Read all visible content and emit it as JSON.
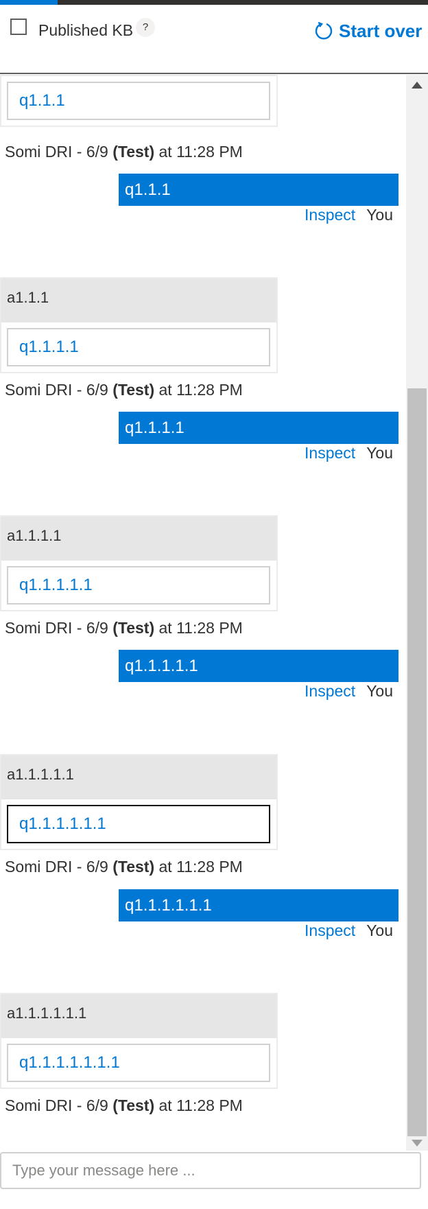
{
  "header": {
    "published_kb_label": "Published KB",
    "published_kb_checked": false,
    "help_glyph": "?",
    "start_over_label": "Start over"
  },
  "conversation": {
    "bot_messages": [
      {
        "text": "",
        "button": "q1.1.1"
      },
      {
        "text": "a1.1.1",
        "button": "q1.1.1.1"
      },
      {
        "text": "a1.1.1.1",
        "button": "q1.1.1.1.1"
      },
      {
        "text": "a1.1.1.1.1",
        "button": "q1.1.1.1.1.1"
      },
      {
        "text": "a1.1.1.1.1.1",
        "button": "q1.1.1.1.1.1.1"
      }
    ],
    "bot_meta": {
      "name": "Somi DRI - 6/9",
      "env": "(Test)",
      "time": "at 11:28 PM"
    },
    "user_messages": [
      {
        "text": "q1.1.1"
      },
      {
        "text": "q1.1.1.1"
      },
      {
        "text": "q1.1.1.1.1"
      },
      {
        "text": "q1.1.1.1.1.1"
      }
    ],
    "inspect_label": "Inspect",
    "you_label": "You"
  },
  "input": {
    "placeholder": "Type your message here ..."
  },
  "colors": {
    "accent": "#0078d4",
    "bot_bubble": "#e6e6e6",
    "text": "#323130"
  },
  "icons": {
    "start_over": "refresh-icon",
    "help": "help-icon"
  }
}
